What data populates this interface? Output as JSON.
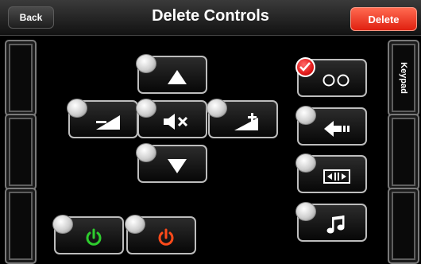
{
  "header": {
    "back_label": "Back",
    "title": "Delete Controls",
    "delete_label": "Delete"
  },
  "right_panel": {
    "keypad_label": "Keypad"
  },
  "controls": [
    {
      "name": "channel-up",
      "icon": "triangle-up-icon",
      "selected": false
    },
    {
      "name": "volume-down",
      "icon": "volume-down-icon",
      "selected": false
    },
    {
      "name": "mute",
      "icon": "mute-icon",
      "selected": false
    },
    {
      "name": "volume-up",
      "icon": "volume-up-icon",
      "selected": false
    },
    {
      "name": "channel-down",
      "icon": "triangle-down-icon",
      "selected": false
    },
    {
      "name": "power-on",
      "icon": "power-icon",
      "color": "#2ecc2e",
      "selected": false
    },
    {
      "name": "power-off",
      "icon": "power-icon",
      "color": "#ff4a1a",
      "selected": false
    },
    {
      "name": "repeat",
      "icon": "double-circle-icon",
      "selected": true
    },
    {
      "name": "back-input",
      "icon": "arrow-left-icon",
      "selected": false
    },
    {
      "name": "aspect",
      "icon": "aspect-icon",
      "selected": false
    },
    {
      "name": "music",
      "icon": "music-note-icon",
      "selected": false
    }
  ],
  "colors": {
    "delete_button": "#e02010",
    "selected_radio": "#e21a1a",
    "power_on": "#2ecc2e",
    "power_off": "#ff4a1a"
  }
}
